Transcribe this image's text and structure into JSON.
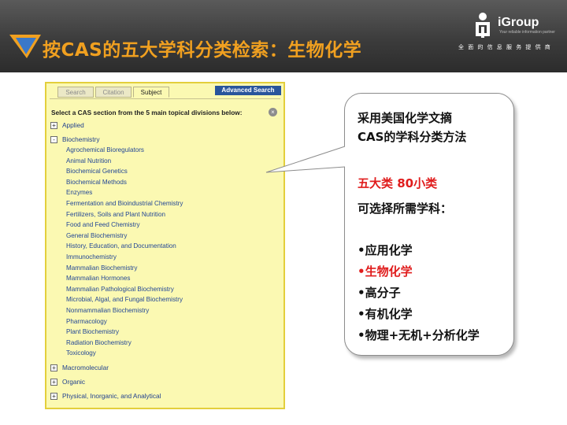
{
  "header": {
    "title": "按CAS的五大学科分类检索：生物化学",
    "logo_text": "iGroup",
    "logo_tagline": "Your reliable information partner",
    "slogan": "全面的信息服务提供商"
  },
  "panel": {
    "tabs": [
      {
        "label": "Search",
        "active": false
      },
      {
        "label": "Citation",
        "active": false
      },
      {
        "label": "Subject",
        "active": true
      }
    ],
    "advanced_search_label": "Advanced Search",
    "instruction": "Select a CAS section from the 5 main topical divisions below:",
    "close_symbol": "×",
    "categories": [
      {
        "label": "Applied",
        "toggle": "+"
      },
      {
        "label": "Biochemistry",
        "toggle": "-"
      },
      {
        "label": "Macromolecular",
        "toggle": "+"
      },
      {
        "label": "Organic",
        "toggle": "+"
      },
      {
        "label": "Physical, Inorganic, and Analytical",
        "toggle": "+"
      }
    ],
    "biochemistry_sections": [
      "Agrochemical Bioregulators",
      "Animal Nutrition",
      "Biochemical Genetics",
      "Biochemical Methods",
      "Enzymes",
      "Fermentation and Bioindustrial Chemistry",
      "Fertilizers, Soils and Plant Nutrition",
      "Food and Feed Chemistry",
      "General Biochemistry",
      "History, Education, and Documentation",
      "Immunochemistry",
      "Mammalian Biochemistry",
      "Mammalian Hormones",
      "Mammalian Pathological Biochemistry",
      "Microbial, Algal, and Fungal Biochemistry",
      "Nonmammalian Biochemistry",
      "Pharmacology",
      "Plant Biochemistry",
      "Radiation Biochemistry",
      "Toxicology"
    ]
  },
  "callout": {
    "line1": "采用美国化学文摘",
    "line2": "CAS的学科分类方法",
    "line3": "五大类 80小类",
    "line4": "可选择所需学科：",
    "subjects": [
      "•应用化学",
      "•生物化学",
      "•高分子",
      "•有机化学",
      "•物理+无机+分析化学"
    ]
  },
  "colors": {
    "title": "#f0a020",
    "highlight": "#e01c1c",
    "panel_background": "#fbf9b2",
    "panel_border": "#e3cf3c",
    "link": "#234796"
  }
}
